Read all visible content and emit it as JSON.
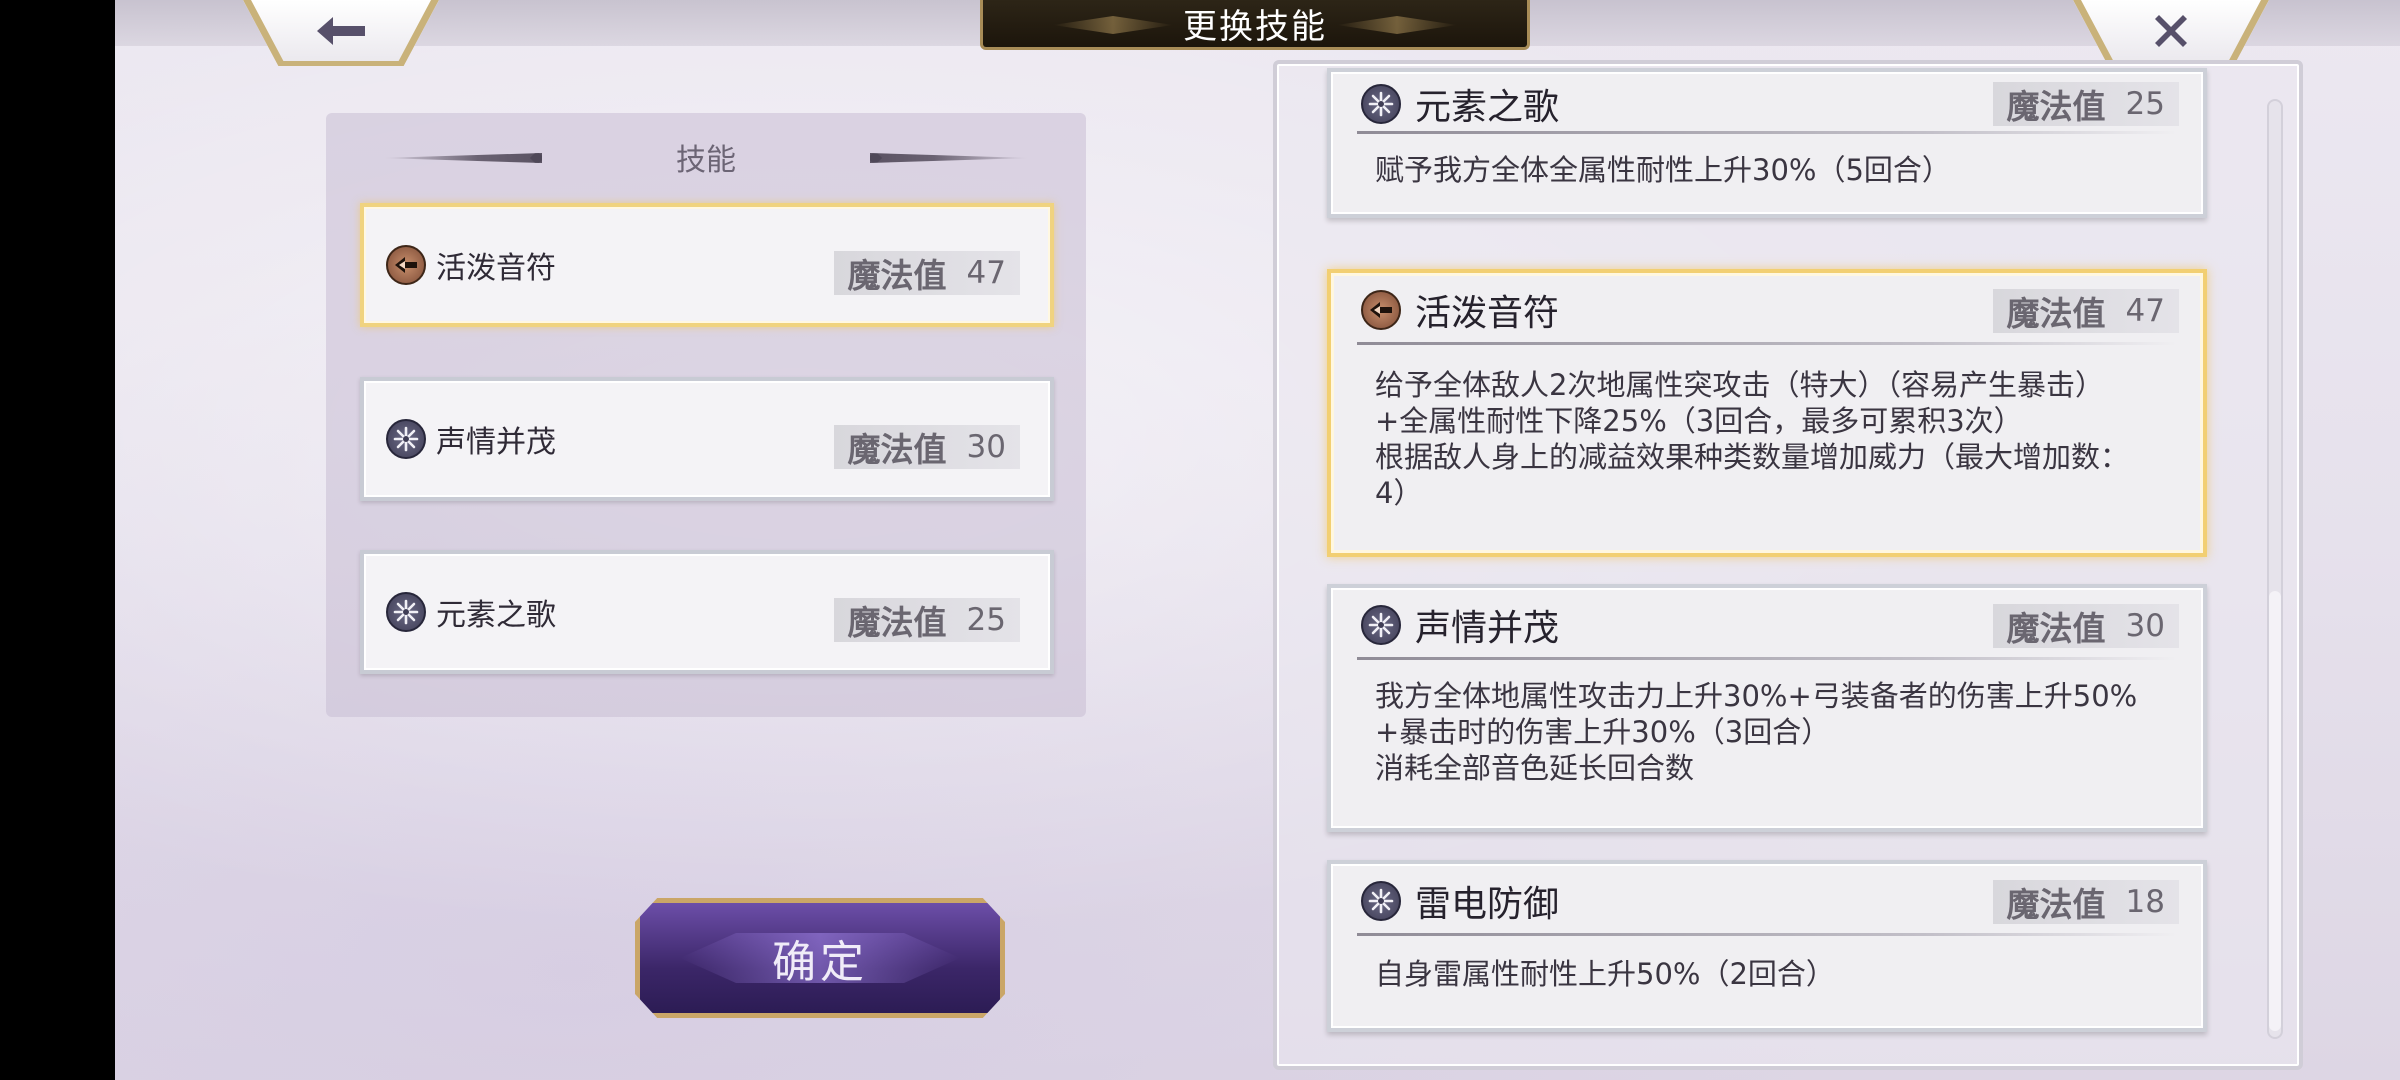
{
  "title": "更换技能",
  "nav": {
    "back_icon": "arrow-left-icon",
    "close_icon": "close-icon"
  },
  "left_panel": {
    "header": "技能",
    "slots": [
      {
        "name": "活泼音符",
        "mp_label": "魔法值",
        "mp": "47",
        "icon": "arrow-icon",
        "selected": true
      },
      {
        "name": "声情并茂",
        "mp_label": "魔法值",
        "mp": "30",
        "icon": "snowflake-icon",
        "selected": false
      },
      {
        "name": "元素之歌",
        "mp_label": "魔法值",
        "mp": "25",
        "icon": "snowflake-icon",
        "selected": false
      }
    ]
  },
  "confirm_label": "确定",
  "skill_list": [
    {
      "name": "元素之歌",
      "mp_label": "魔法值",
      "mp": "25",
      "icon": "snowflake-icon",
      "desc": [
        "赋予我方全体全属性耐性上升30%（5回合）"
      ]
    },
    {
      "name": "活泼音符",
      "mp_label": "魔法值",
      "mp": "47",
      "icon": "arrow-icon",
      "selected": true,
      "desc": [
        "给予全体敌人2次地属性突攻击（特大）（容易产生暴击）",
        "+全属性耐性下降25%（3回合，最多可累积3次）",
        "根据敌人身上的减益效果种类数量增加威力（最大增加数：",
        "4）"
      ]
    },
    {
      "name": "声情并茂",
      "mp_label": "魔法值",
      "mp": "30",
      "icon": "snowflake-icon",
      "desc": [
        "我方全体地属性攻击力上升30%+弓装备者的伤害上升50%",
        "+暴击时的伤害上升30%（3回合）",
        "消耗全部音色延长回合数"
      ]
    },
    {
      "name": "雷电防御",
      "mp_label": "魔法值",
      "mp": "18",
      "icon": "snowflake-icon",
      "desc": [
        "自身雷属性耐性上升50%（2回合）"
      ]
    }
  ]
}
